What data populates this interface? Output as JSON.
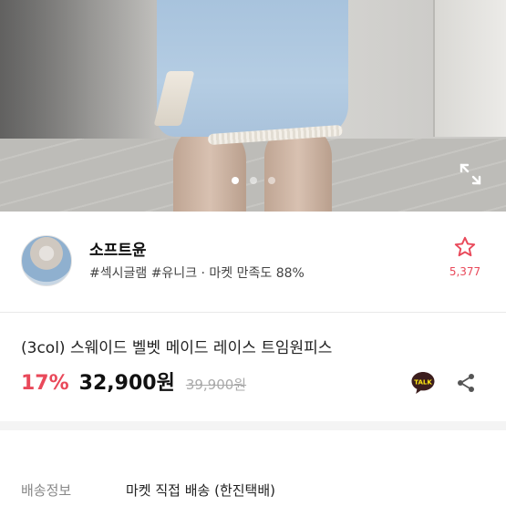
{
  "hero": {
    "image_label": "product photo",
    "page_indicator": {
      "total": 3,
      "active": 1
    }
  },
  "icons": {
    "expand": "expand-arrows-icon",
    "favorite": "star-outline-icon",
    "talk": "kakaotalk-icon",
    "share": "share-icon"
  },
  "seller": {
    "name": "소프트윤",
    "tags": "#섹시글램 #유니크 · 마켓 만족도 88%",
    "favorite_count": "5,377"
  },
  "product": {
    "title": "(3col) 스웨이드 벨벳 메이드 레이스 트임원피스",
    "discount": "17%",
    "price": "32,900원",
    "original_price": "39,900원",
    "talk_label": "TALK"
  },
  "delivery": {
    "label": "배송정보",
    "value": "마켓 직접 배송 (한진택배)"
  },
  "colors": {
    "accent_red": "#e9495a",
    "talk_bg": "#3c1e1e",
    "talk_text": "#ffe812"
  }
}
